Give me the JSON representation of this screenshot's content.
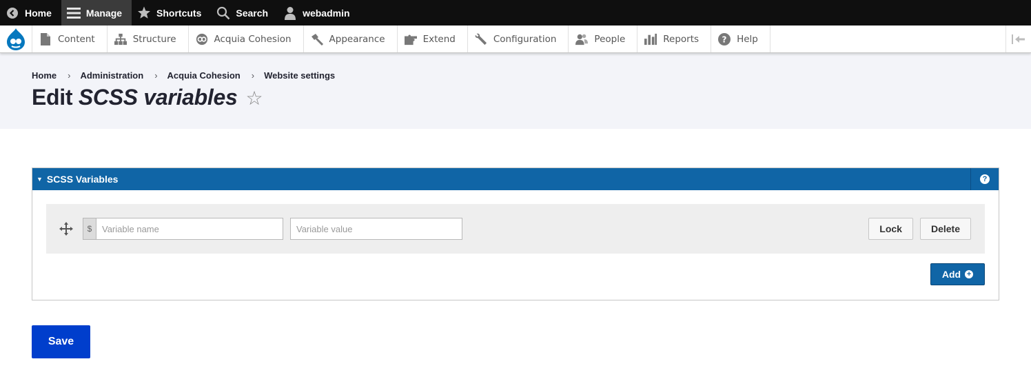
{
  "toolbar": {
    "items": [
      {
        "label": "Home",
        "icon": "back-circle-icon"
      },
      {
        "label": "Manage",
        "icon": "hamburger-icon"
      },
      {
        "label": "Shortcuts",
        "icon": "star-icon"
      },
      {
        "label": "Search",
        "icon": "search-icon"
      },
      {
        "label": "webadmin",
        "icon": "user-icon"
      }
    ]
  },
  "admin_menu": {
    "items": [
      {
        "label": "Content",
        "icon": "file-icon"
      },
      {
        "label": "Structure",
        "icon": "sitemap-icon"
      },
      {
        "label": "Acquia Cohesion",
        "icon": "cohesion-icon"
      },
      {
        "label": "Appearance",
        "icon": "paintbrush-icon"
      },
      {
        "label": "Extend",
        "icon": "puzzle-icon"
      },
      {
        "label": "Configuration",
        "icon": "wrench-icon"
      },
      {
        "label": "People",
        "icon": "people-icon"
      },
      {
        "label": "Reports",
        "icon": "bar-chart-icon"
      },
      {
        "label": "Help",
        "icon": "help-icon"
      }
    ]
  },
  "breadcrumb": [
    "Home",
    "Administration",
    "Acquia Cohesion",
    "Website settings"
  ],
  "page": {
    "title_prefix": "Edit",
    "title_emphasis": "SCSS variables"
  },
  "fieldset": {
    "title": "SCSS Variables",
    "help_icon": "?"
  },
  "variable_row": {
    "prefix": "$",
    "name_placeholder": "Variable name",
    "value_placeholder": "Variable value",
    "lock_label": "Lock",
    "delete_label": "Delete"
  },
  "add_label": "Add",
  "save_label": "Save",
  "colors": {
    "accent_blue": "#1065a6",
    "save_blue": "#003ecc",
    "toolbar_black": "#0f0f0f",
    "drupal_logo": "#0678be"
  }
}
